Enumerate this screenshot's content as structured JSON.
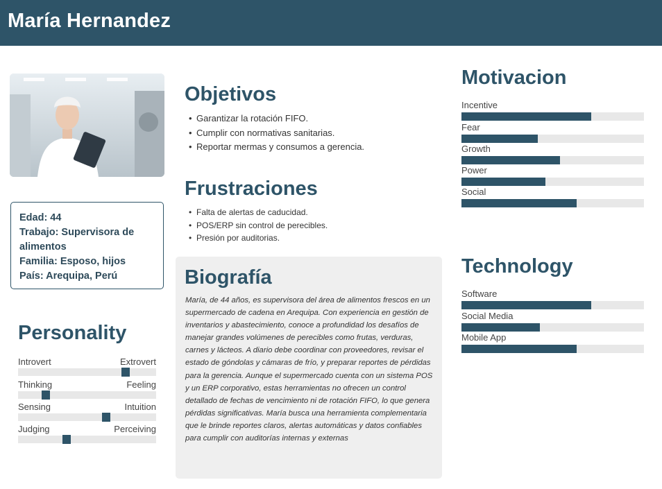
{
  "header": {
    "name": "María Hernandez"
  },
  "profile": {
    "photo_icon": "person-photo",
    "info": [
      "Edad: 44",
      "Trabajo: Supervisora de alimentos",
      "Familia: Esposo, hijos",
      "País: Arequipa, Perú"
    ]
  },
  "objectives": {
    "title": "Objetivos",
    "items": [
      "Garantizar la rotación FIFO.",
      "Cumplir con normativas sanitarias.",
      "Reportar mermas y consumos a gerencia."
    ]
  },
  "frustrations": {
    "title": "Frustraciones",
    "items": [
      "Falta de alertas de caducidad.",
      "POS/ERP sin control de perecibles.",
      "Presión por auditorias."
    ]
  },
  "biography": {
    "title": "Biografía",
    "text": "María, de 44 años, es supervisora del área de alimentos frescos en un supermercado de cadena en Arequipa. Con experiencia en gestión de inventarios y abastecimiento, conoce a profundidad los desafíos de manejar grandes volúmenes de perecibles como frutas, verduras, carnes y lácteos. A diario debe coordinar con proveedores, revisar el estado de góndolas y cámaras de frío, y preparar reportes de pérdidas para la gerencia. Aunque el supermercado cuenta con un sistema POS y un ERP corporativo, estas herramientas no ofrecen un control detallado de fechas de vencimiento ni de rotación FIFO, lo que genera pérdidas significativas. María busca una herramienta complementaria que le brinde reportes claros, alertas automáticas y datos confiables para cumplir con auditorías internas y externas"
  },
  "personality": {
    "title": "Personality",
    "traits": [
      {
        "left": "Introvert",
        "right": "Extrovert",
        "level": 0.78
      },
      {
        "left": "Thinking",
        "right": "Feeling",
        "level": 0.2
      },
      {
        "left": "Sensing",
        "right": "Intuition",
        "level": 0.64
      },
      {
        "left": "Judging",
        "right": "Perceiving",
        "level": 0.35
      }
    ]
  },
  "motivation": {
    "title": "Motivacion",
    "items": [
      {
        "label": "Incentive",
        "level": 0.71
      },
      {
        "label": "Fear",
        "level": 0.42
      },
      {
        "label": "Growth",
        "level": 0.54
      },
      {
        "label": "Power",
        "level": 0.46
      },
      {
        "label": "Social",
        "level": 0.63
      }
    ]
  },
  "technology": {
    "title": "Technology",
    "items": [
      {
        "label": "Software",
        "level": 0.71
      },
      {
        "label": "Social Media",
        "level": 0.43
      },
      {
        "label": "Mobile App",
        "level": 0.63
      }
    ]
  },
  "colors": {
    "accent": "#2e5468",
    "track": "#e8e8e8",
    "panel": "#efefef"
  }
}
